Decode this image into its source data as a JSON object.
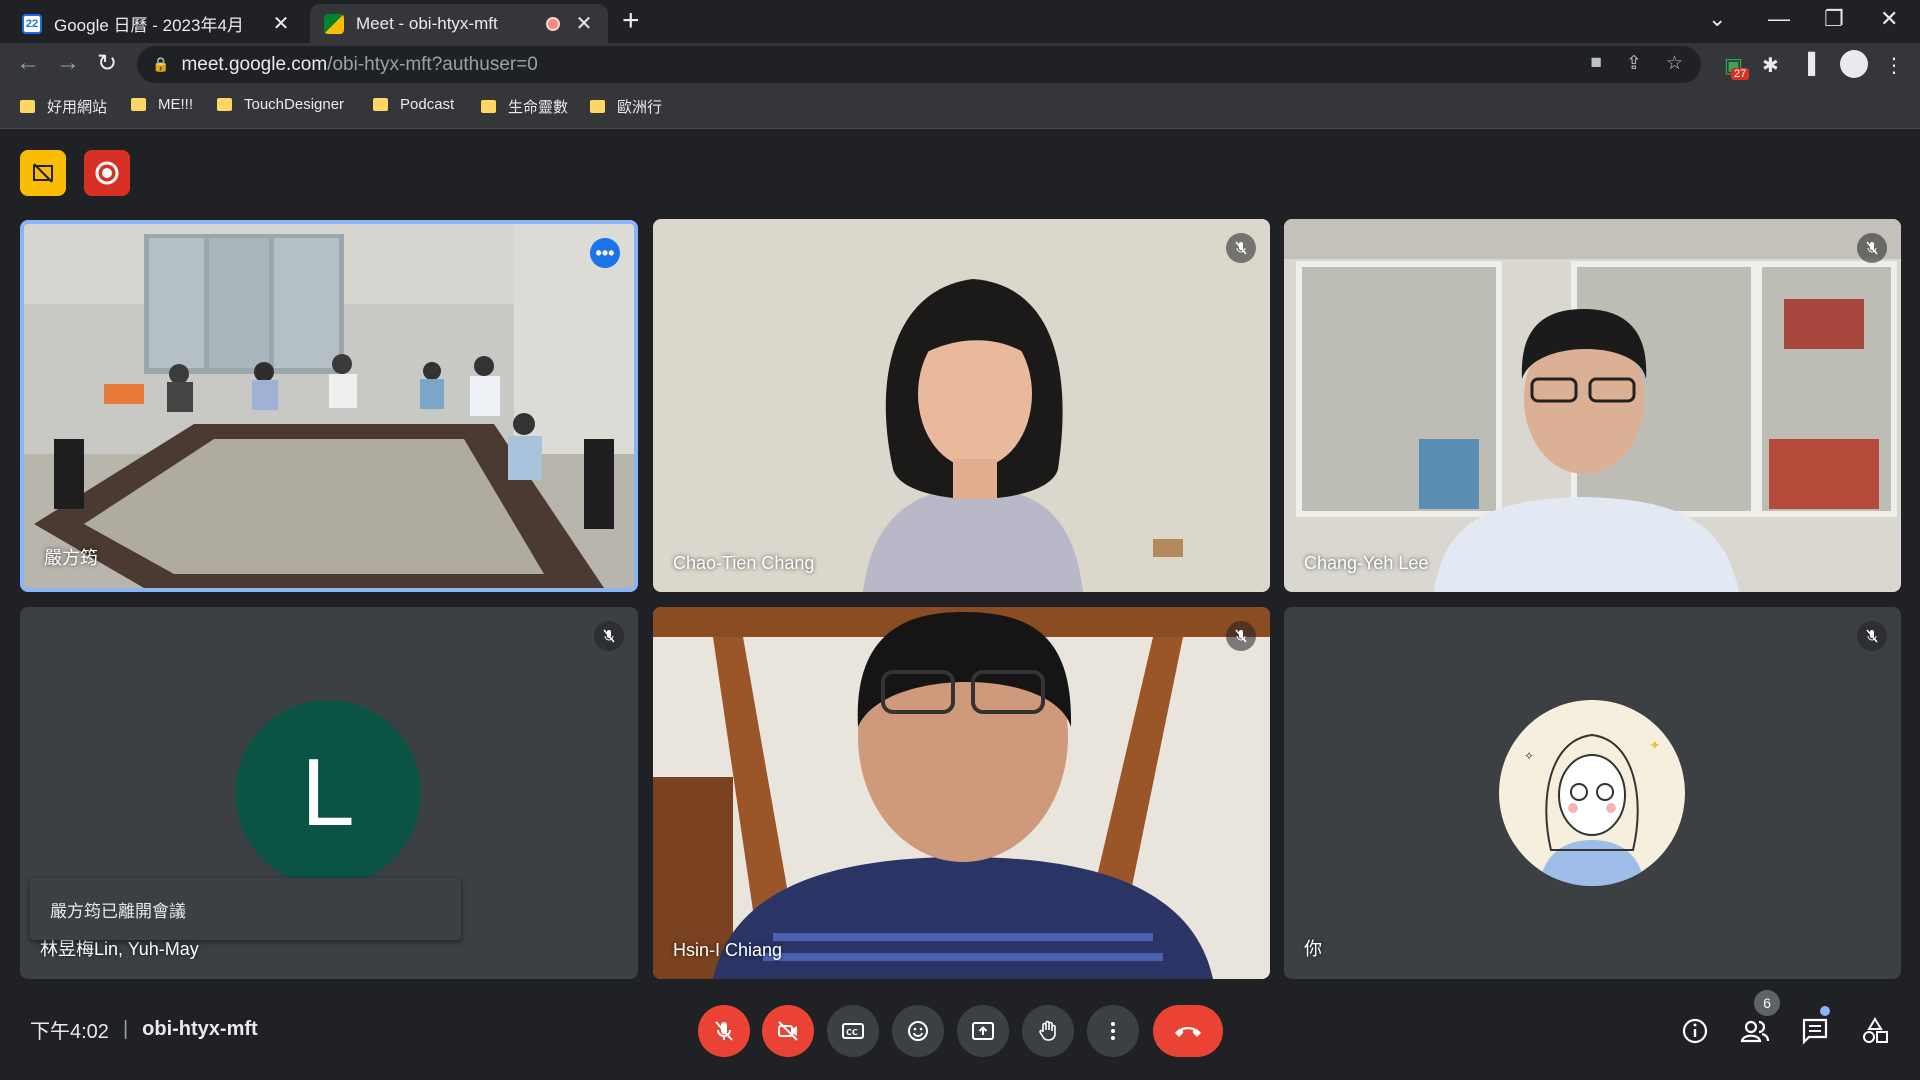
{
  "browser": {
    "tabs": [
      {
        "title": "Google 日曆 - 2023年4月",
        "favicon": "calendar-icon",
        "favicon_text": "22",
        "active": false
      },
      {
        "title": "Meet - obi-htyx-mft",
        "favicon": "meet-icon",
        "active": true,
        "recording": true
      }
    ],
    "url_host": "meet.google.com",
    "url_path": "/obi-htyx-mft?authuser=0",
    "extension_badge": "27",
    "bookmarks": [
      "好用網站",
      "ME!!!",
      "TouchDesigner",
      "Podcast",
      "生命靈數",
      "歐洲行"
    ]
  },
  "meeting": {
    "time": "下午4:02",
    "code": "obi-htyx-mft",
    "participant_count": "6",
    "toast": "嚴方筠已離開會議",
    "tiles": [
      {
        "name": "嚴方筠",
        "type": "video",
        "muted": false,
        "speaking": true
      },
      {
        "name": "Chao-Tien Chang",
        "type": "video",
        "muted": true
      },
      {
        "name": "Chang-Yeh Lee",
        "type": "video",
        "muted": true
      },
      {
        "name": "林昱梅Lin, Yuh-May",
        "type": "avatar",
        "initial": "L",
        "muted": true
      },
      {
        "name": "Hsin-I Chiang",
        "type": "video",
        "muted": true
      },
      {
        "name": "你",
        "type": "avatar",
        "muted": true
      }
    ]
  },
  "colors": {
    "background": "#202124",
    "tile": "#3c4043",
    "speaking_border": "#8ab4f8",
    "danger": "#ea4335",
    "avatar_green": "#0b5345"
  }
}
